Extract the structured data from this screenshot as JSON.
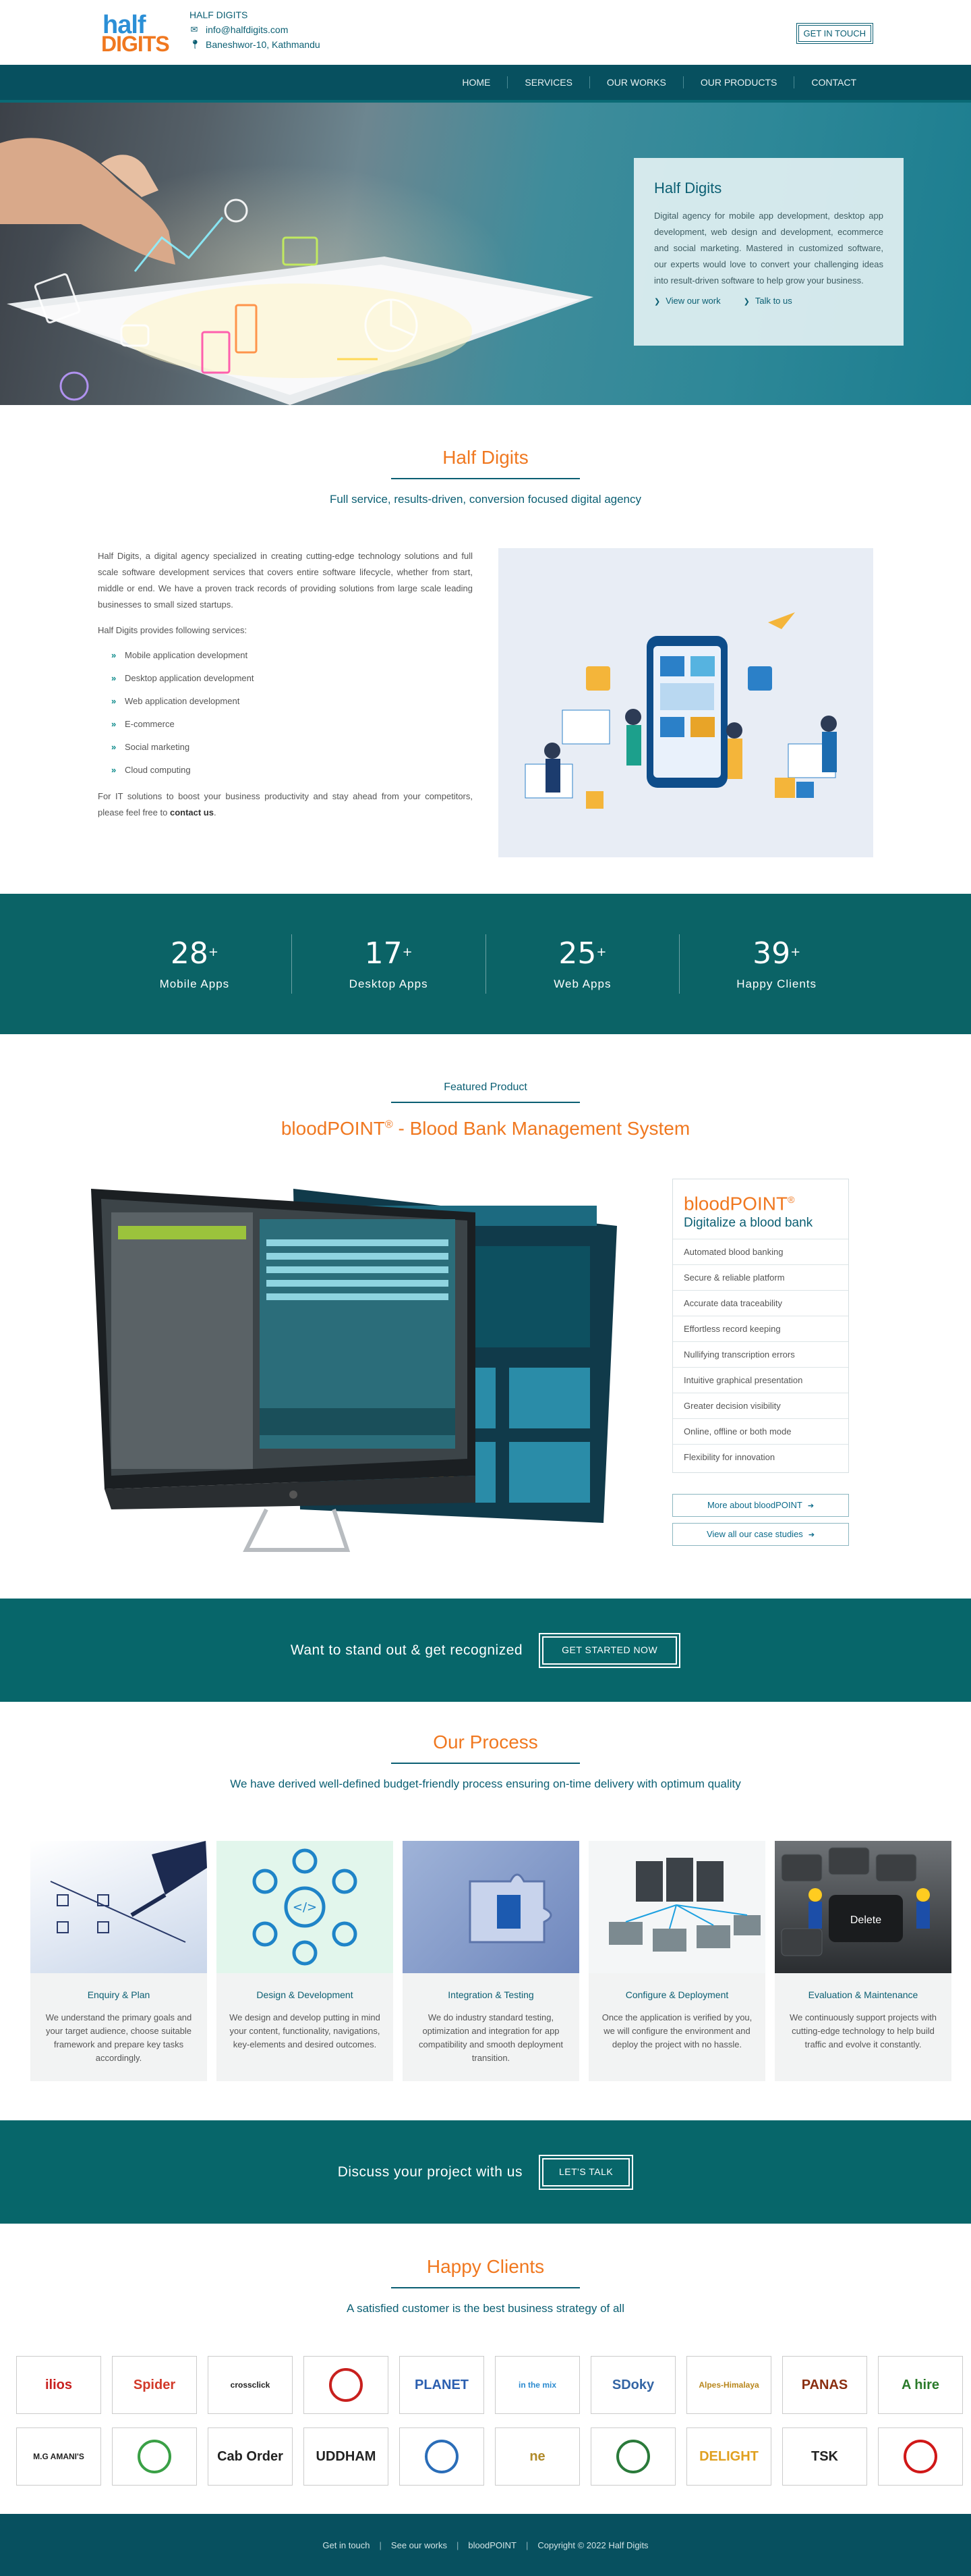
{
  "header": {
    "company": "HALF DIGITS",
    "email": "info@halfdigits.com",
    "address": "Baneshwor-10, Kathmandu",
    "cta": "GET IN TOUCH",
    "logo_line1": "half",
    "logo_line2": "DIGITS",
    "icons": [
      "envelope-icon",
      "map-pin-icon"
    ]
  },
  "nav": [
    "HOME",
    "SERVICES",
    "OUR WORKS",
    "OUR PRODUCTS",
    "CONTACT"
  ],
  "hero": {
    "title": "Half Digits",
    "text": "Digital agency for mobile app development, desktop app development, web design and development, ecommerce and social marketing. Mastered in customized software, our experts would love to convert your challenging ideas into result-driven software to help grow your business.",
    "link1": "View our work",
    "link2": "Talk to us"
  },
  "about": {
    "title": "Half Digits",
    "subtitle": "Full service, results-driven, conversion focused digital agency",
    "p1": "Half Digits, a digital agency specialized in creating cutting-edge technology solutions and full scale software development services that covers entire software lifecycle, whether from start, middle or end. We have a proven track records of providing solutions from large scale leading businesses to small sized startups.",
    "p2": "Half Digits provides following services:",
    "services": [
      "Mobile application development",
      "Desktop application development",
      "Web application development",
      "E-commerce",
      "Social marketing",
      "Cloud computing"
    ],
    "p3_before": "For IT solutions to boost your business productivity and stay ahead from your competitors, please feel free to ",
    "p3_link": "contact us",
    "p3_after": "."
  },
  "stats": [
    {
      "num": "28",
      "sup": "+",
      "label": "Mobile Apps"
    },
    {
      "num": "17",
      "sup": "+",
      "label": "Desktop Apps"
    },
    {
      "num": "25",
      "sup": "+",
      "label": "Web Apps"
    },
    {
      "num": "39",
      "sup": "+",
      "label": "Happy Clients"
    }
  ],
  "featured": {
    "label": "Featured Product",
    "title_a": "bloodPOINT",
    "title_reg": "®",
    "title_b": " - Blood Bank Management System",
    "card_title": "bloodPOINT",
    "card_reg": "®",
    "card_sub": "Digitalize a blood bank",
    "features": [
      "Automated blood banking",
      "Secure & reliable platform",
      "Accurate data traceability",
      "Effortless record keeping",
      "Nullifying transcription errors",
      "Intuitive graphical presentation",
      "Greater decision visibility",
      "Online, offline or both mode",
      "Flexibility for innovation"
    ],
    "btn1": "More about bloodPOINT",
    "btn2": "View all our case studies"
  },
  "cta1": {
    "text": "Want to stand out & get recognized",
    "button": "GET STARTED NOW"
  },
  "process": {
    "title": "Our Process",
    "subtitle": "We have derived well-defined budget-friendly process ensuring on-time delivery with optimum quality",
    "steps": [
      {
        "title": "Enquiry & Plan",
        "desc": "We understand the primary goals and your target audience, choose suitable framework and prepare key tasks accordingly."
      },
      {
        "title": "Design & Development",
        "desc": "We design and develop putting in mind your content, functionality, navigations, key-elements and desired outcomes."
      },
      {
        "title": "Integration & Testing",
        "desc": "We do industry standard testing, optimization and integration for app compatibility and smooth deployment transition."
      },
      {
        "title": "Configure & Deployment",
        "desc": "Once the application is verified by you, we will configure the environment and deploy the project with no hassle."
      },
      {
        "title": "Evaluation & Maintenance",
        "desc": "We continuously support projects with cutting-edge technology to help build traffic and evolve it constantly."
      }
    ]
  },
  "cta2": {
    "text": "Discuss your project with us",
    "button": "LET'S TALK"
  },
  "clients": {
    "title": "Happy Clients",
    "subtitle": "A satisfied customer is the best business strategy of all",
    "logos": [
      {
        "name": "ilios",
        "text": "ilios",
        "color": "#c8201e"
      },
      {
        "name": "spider",
        "text": "Spider",
        "color": "#d23a2a"
      },
      {
        "name": "crossclick",
        "text": "crossclick",
        "color": "#222222"
      },
      {
        "name": "heart-logo",
        "text": "",
        "color": "#c8201e"
      },
      {
        "name": "planet-guides",
        "text": "PLANET",
        "color": "#2b5fb0"
      },
      {
        "name": "in-the-mix",
        "text": "in the mix",
        "color": "#2a8ad0"
      },
      {
        "name": "sdoky",
        "text": "SDoky",
        "color": "#3465a4"
      },
      {
        "name": "alpes-himalaya",
        "text": "Alpes-Himalaya",
        "color": "#b8861c"
      },
      {
        "name": "panas",
        "text": "PANAS",
        "color": "#8a2e10"
      },
      {
        "name": "a-hire",
        "text": "A hire",
        "color": "#2a7a2a"
      },
      {
        "name": "m-g-amanis",
        "text": "M.G AMANI'S",
        "color": "#222222"
      },
      {
        "name": "green-flower",
        "text": "",
        "color": "#3aa046"
      },
      {
        "name": "cab-order",
        "text": "Cab Order",
        "color": "#222222"
      },
      {
        "name": "uddham",
        "text": "UDDHAM",
        "color": "#222222"
      },
      {
        "name": "round-seal",
        "text": "",
        "color": "#2a6db8"
      },
      {
        "name": "ene",
        "text": "ne",
        "color": "#b08a2a"
      },
      {
        "name": "eye-logo",
        "text": "",
        "color": "#2a7a3a"
      },
      {
        "name": "delight",
        "text": "DELIGHT",
        "color": "#e0a020"
      },
      {
        "name": "tsk",
        "text": "TSK",
        "color": "#222222"
      },
      {
        "name": "red-star",
        "text": "",
        "color": "#d01818"
      }
    ]
  },
  "footer": {
    "links": [
      "Get in touch",
      "See our works",
      "bloodPOINT"
    ],
    "copyright": "Copyright © 2022 Half Digits"
  }
}
